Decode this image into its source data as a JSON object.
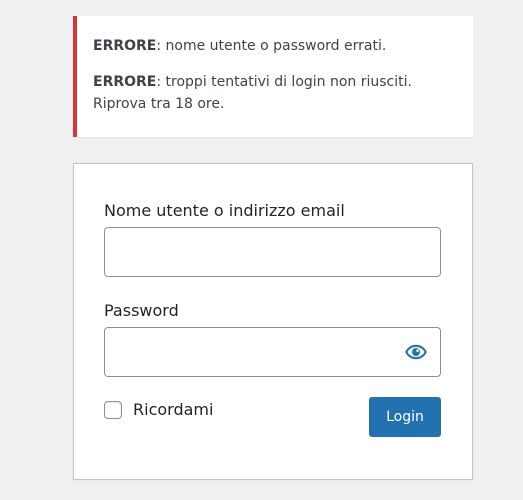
{
  "colors": {
    "page_background": "#f0f0f1",
    "error_accent": "#d63638",
    "primary_button": "#2271b1",
    "eye_icon": "#2271b1",
    "input_border": "#8c8f94"
  },
  "error_notice": {
    "messages": [
      {
        "prefix": "ERRORE",
        "text": ": nome utente o password errati."
      },
      {
        "prefix": "ERRORE",
        "text": ": troppi tentativi di login non riusciti. Riprova tra 18 ore."
      }
    ]
  },
  "login_form": {
    "username_label": "Nome utente o indirizzo email",
    "username_value": "",
    "password_label": "Password",
    "password_value": "",
    "show_password_icon": "eye-icon",
    "remember_label": "Ricordami",
    "remember_checked": false,
    "submit_label": "Login"
  }
}
